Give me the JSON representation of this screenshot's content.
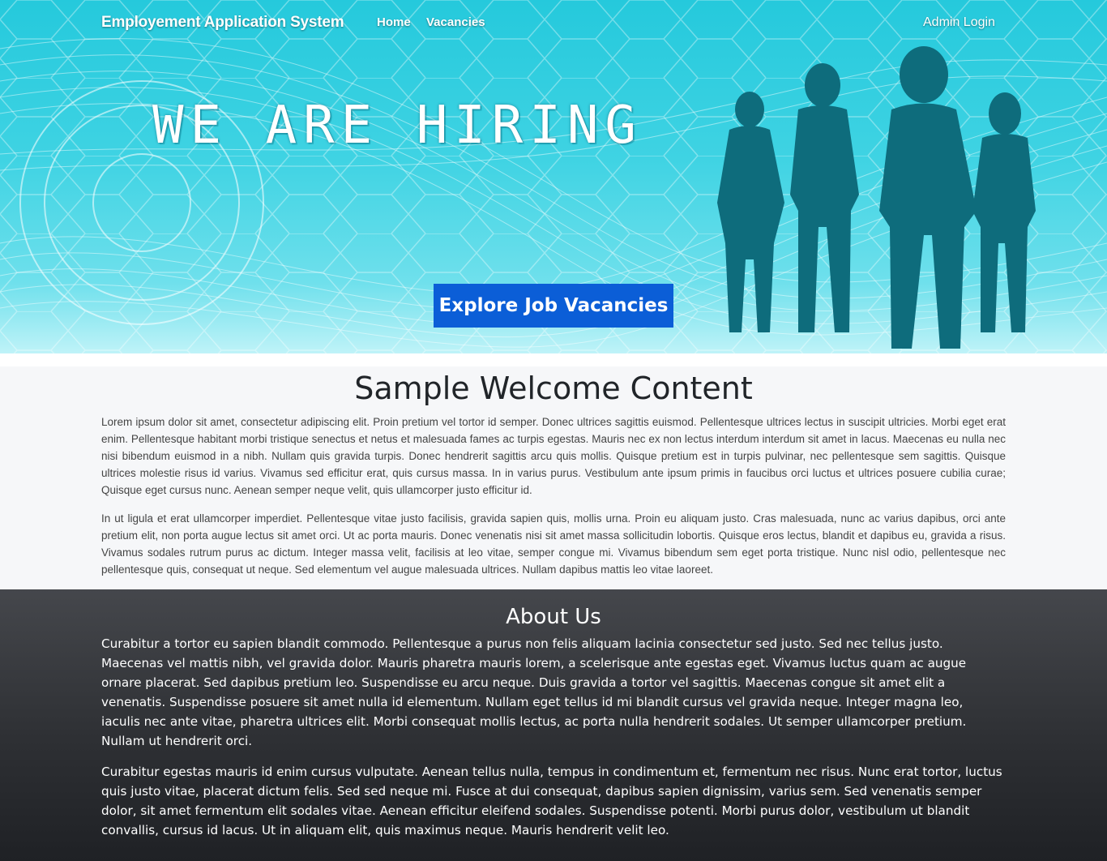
{
  "nav": {
    "brand": "Employement Application System",
    "home": "Home",
    "vacancies": "Vacancies",
    "admin_login": "Admin Login"
  },
  "hero": {
    "headline": "WE ARE HIRING",
    "cta_label": "Explore Job Vacancies",
    "cta_color": "#0b5ed7"
  },
  "welcome": {
    "title": "Sample Welcome Content",
    "paragraphs": [
      "Lorem ipsum dolor sit amet, consectetur adipiscing elit. Proin pretium vel tortor id semper. Donec ultrices sagittis euismod. Pellentesque ultrices lectus in suscipit ultricies. Morbi eget erat enim. Pellentesque habitant morbi tristique senectus et netus et malesuada fames ac turpis egestas. Mauris nec ex non lectus interdum interdum sit amet in lacus. Maecenas eu nulla nec nisi bibendum euismod in a nibh. Nullam quis gravida turpis. Donec hendrerit sagittis arcu quis mollis. Quisque pretium est in turpis pulvinar, nec pellentesque sem sagittis. Quisque ultrices molestie risus id varius. Vivamus sed efficitur erat, quis cursus massa. In in varius purus. Vestibulum ante ipsum primis in faucibus orci luctus et ultrices posuere cubilia curae; Quisque eget cursus nunc. Aenean semper neque velit, quis ullamcorper justo efficitur id.",
      "In ut ligula et erat ullamcorper imperdiet. Pellentesque vitae justo facilisis, gravida sapien quis, mollis urna. Proin eu aliquam justo. Cras malesuada, nunc ac varius dapibus, orci ante pretium elit, non porta augue lectus sit amet orci. Ut ac porta mauris. Donec venenatis nisi sit amet massa sollicitudin lobortis. Quisque eros lectus, blandit et dapibus eu, gravida a risus. Vivamus sodales rutrum purus ac dictum. Integer massa velit, facilisis at leo vitae, semper congue mi. Vivamus bibendum sem eget porta tristique. Nunc nisl odio, pellentesque nec pellentesque quis, consequat ut neque. Sed elementum vel augue malesuada ultrices. Nullam dapibus mattis leo vitae laoreet."
    ]
  },
  "about": {
    "title": "About Us",
    "paragraphs": [
      "Curabitur a tortor eu sapien blandit commodo. Pellentesque a purus non felis aliquam lacinia consectetur sed justo. Sed nec tellus justo. Maecenas vel mattis nibh, vel gravida dolor. Mauris pharetra mauris lorem, a scelerisque ante egestas eget. Vivamus luctus quam ac augue ornare placerat. Sed dapibus pretium leo. Suspendisse eu arcu neque. Duis gravida a tortor vel sagittis. Maecenas congue sit amet elit a venenatis. Suspendisse posuere sit amet nulla id elementum. Nullam eget tellus id mi blandit cursus vel gravida neque. Integer magna leo, iaculis nec ante vitae, pharetra ultrices elit. Morbi consequat mollis lectus, ac porta nulla hendrerit sodales. Ut semper ullamcorper pretium. Nullam ut hendrerit orci.",
      "Curabitur egestas mauris id enim cursus vulputate. Aenean tellus nulla, tempus in condimentum et, fermentum nec risus. Nunc erat tortor, luctus quis justo vitae, placerat dictum felis. Sed sed neque mi. Fusce at dui consequat, dapibus sapien dignissim, varius sem. Sed venenatis semper dolor, sit amet fermentum elit sodales vitae. Aenean efficitur eleifend sodales. Suspendisse potenti. Morbi purus dolor, vestibulum ut blandit convallis, cursus id lacus. Ut in aliquam elit, quis maximus neque. Mauris hendrerit velit leo."
    ]
  }
}
